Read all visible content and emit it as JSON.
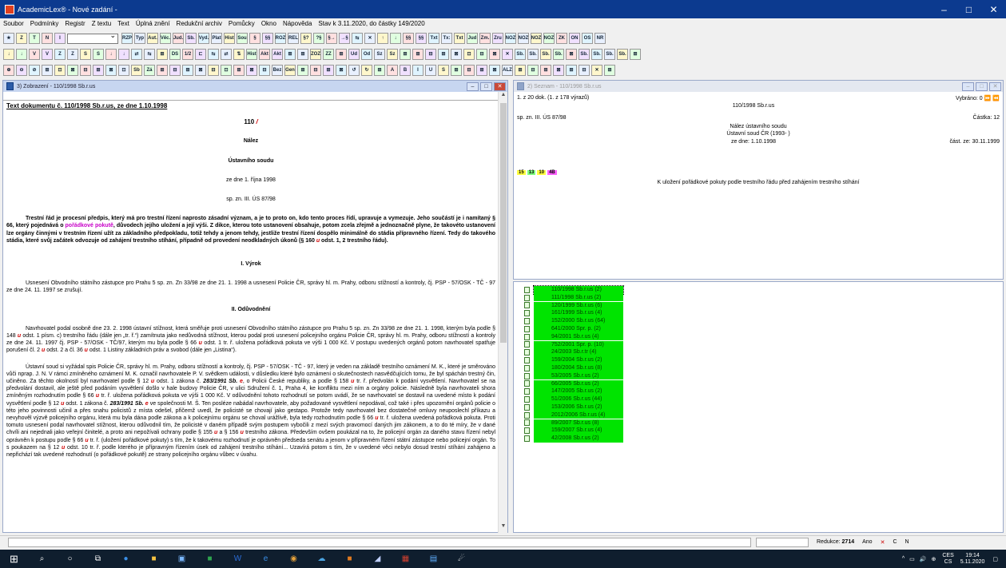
{
  "window": {
    "title": "AcademicLex® - Nové zadání -",
    "controls": [
      "–",
      "□",
      "✕"
    ]
  },
  "menu": [
    "Soubor",
    "Podmínky",
    "Registr",
    "Z textu",
    "Text",
    "Úplná znění",
    "Redukční archiv",
    "Pomůcky",
    "Okno",
    "Nápověda",
    "Stav k 3.11.2020, do částky 149/2020"
  ],
  "toolbar": {
    "row1a": [
      "Z",
      "T",
      "N",
      "I"
    ],
    "row1b": [
      "RZP",
      "Typ",
      "Aut.",
      "Věc.",
      "Jud.",
      "Sb.",
      "Vyd.",
      "Plat",
      "Hist",
      "Sou",
      "§",
      "§§",
      "ROZ",
      "REL",
      "§?",
      "?§",
      "§→",
      "→§",
      "⇆",
      "✕",
      "↑",
      "↓",
      "§§",
      "§§",
      "Txt",
      "Tx:",
      "Txt",
      "Jud",
      "Zm.",
      "Zru",
      "NOZ",
      "NOZ",
      "NOZ",
      "NOZ",
      "ZK",
      "ON",
      "OS",
      "NR"
    ],
    "row2": [
      "↓",
      "↓",
      "V",
      "V",
      "Z",
      "Z",
      "S",
      "S",
      "↓",
      "↓",
      "⇄",
      "⇆",
      "⊞",
      "DS",
      "1/2",
      "⊏",
      "⇆",
      "⇄",
      "⇅",
      "Hist",
      "Akt",
      "Akt",
      "⊞",
      "⊞",
      "ZOZ",
      "ZZ",
      "⊞",
      "Ud",
      "Od",
      "Sz",
      "Sz",
      "⊞",
      "⊞",
      "⊟",
      "⊞",
      "⊠",
      "⊡",
      "⊟",
      "⊠",
      "✕",
      "Sb.",
      "Sb.",
      "Sb.",
      "Sb.",
      "⊠",
      "Sb.",
      "Sb.",
      "Sb.",
      "Sb.",
      "⊞"
    ],
    "row3": [
      "⊕",
      "⊖",
      "⊘",
      "⊞",
      "⊡",
      "⊠",
      "⊟",
      "⊞",
      "⊠",
      "⊡",
      "Sb",
      "Zá",
      "⊞",
      "⊟",
      "⊞",
      "⊠",
      "⊟",
      "⊡",
      "⊞",
      "⊠",
      "⊟",
      "Bez",
      "Gen",
      "⊞",
      "⊟",
      "⊞",
      "⊠",
      "↺",
      "↻",
      "⊞",
      "A",
      "B",
      "I",
      "U",
      "S",
      "⊞",
      "⊟",
      "⊞",
      "⊠",
      "ALZ",
      "⊞",
      "⊟",
      "⊞",
      "⊠",
      "⊞",
      "⊟",
      "✕",
      "⊞"
    ]
  },
  "left_pane": {
    "title": "3) Zobrazení - 110/1998 Sb.r.us"
  },
  "doc": {
    "header": "Text dokumentu č. 110/1998 Sb.r.us, ze dne 1.10.1998",
    "num": "110 ",
    "num_suffix": "/",
    "nalez": "Nález",
    "court": "Ústavního soudu",
    "date": "ze dne 1. října 1998",
    "spzn": "sp. zn. III. ÚS 87/98",
    "summary_a": "Trestní řád je procesní předpis, který má pro trestní řízení naprosto zásadní význam, a je to proto on, kdo tento proces řídí, upravuje a vymezuje. Jeho součástí je i namítaný § 66, který pojednává o ",
    "summary_hl": "pořádkové pokutě",
    "summary_b": ", důvodech jejího uložení a její výši. Z dikce, kterou toto ustanovení obsahuje, potom zcela zřejmě a jednoznačně plyne, že takovéto ustanovení lze orgány činnými v trestním řízení užít za základního předpokladu, totiž tehdy a jenom tehdy, jestliže trestní řízení dospělo minimálně do stádia přípravného řízení. Tedy do takového stádia, které svůj začátek odvozuje od zahájení trestního stíhání, případně od provedení neodkladných úkonů (§ 160 ",
    "summary_u": "u",
    "summary_c": " odst. 1, 2 trestního řádu).",
    "sec1": "I. Výrok",
    "vyrok": "Usnesení Obvodního státního zástupce pro Prahu 5 sp. zn. Zn 33/98 ze dne 21. 1. 1998 a usnesení Policie ČR, správy hl. m. Prahy, odboru stížností a kontroly, čj. PSP - 57/OSK - TČ - 97 ze dne 24. 11. 1997 se zrušují.",
    "sec2": "II. Odůvodnění",
    "p1_a": "Navrhovatel podal osobně dne 23. 2. 1998 ústavní stížnost, která směřuje proti usnesení Obvodního státního zástupce pro Prahu 5 sp. zn. Zn 33/98 ze dne 21. 1. 1998, kterým byla podle § 148 ",
    "p1_u1": "u",
    "p1_b": " odst. 1 písm. c) trestního řádu (dále jen „tr. ř.“) zamítnuta jako nedůvodná stížnost, kterou podal proti usnesení policejního orgánu Policie ČR, správy hl. m. Prahy, odboru stížností a kontroly ze dne 24. 11. 1997 čj. PSP - 57/OSK - TČ/97, kterým mu byla podle § 66 ",
    "p1_u2": "u",
    "p1_c": " odst. 1 tr. ř. uložena pořádková pokuta ve výši 1 000 Kč. V postupu uvedených orgánů potom navrhovatel spatřuje porušení čl. 2 ",
    "p1_u3": "u",
    "p1_d": " odst. 2 a čl. 36 ",
    "p1_u4": "u",
    "p1_e": " odst. 1 Listiny základních práv a svobod (dále jen „Listina“).",
    "p2_a": "Ústavní soud si vyžádal spis Policie ČR, správy hl. m. Prahy, odboru stížností a kontroly, čj. PSP - 57/OSK - TČ - 97, který je veden na základě trestního oznámení M. K., které je směrováno vůči nprap. J. N. V rámci zmíněného oznámení M. K. označil navrhovatele P. V. svědkem události, v důsledku které bylo oznámení o skutečnostech nasvědčujících tomu, že byl spáchán trestný čin, učiněno. Za těchto okolností byl navrhovatel podle § 12 ",
    "p2_u1": "u",
    "p2_b": " odst. 1 zákona č. ",
    "p2_law1": "283/1991 Sb.",
    "p2_e1": " e",
    "p2_c": ", o Policii České republiky, a podle § 158 ",
    "p2_u2": "u",
    "p2_d": " tr. ř. předvolán k podání vysvětlení. Navrhovatel se na předvolání dostavil, ale ještě před podáním vysvětlení došlo v hale budovy Policie ČR, v ulici Sdružení č. 1, Praha 4, ke konfliktu mezi ním a orgány policie. Následně byla navrhovateli shora zmíněným rozhodnutím podle § 66 ",
    "p2_u3": "u",
    "p2_f": " tr. ř. uložena pořádková pokuta ve výši 1 000 Kč. V odůvodnění tohoto rozhodnutí se potom uvádí, že se navrhovatel se dostavil na uvedené místo k podání vysvětlení podle § 12 ",
    "p2_u4": "u",
    "p2_g": " odst. 1 zákona č. ",
    "p2_law2": "283/1991 Sb.",
    "p2_e2": " e",
    "p2_h": " ve společnosti M. Š. Ten posléze nabádal navrhovatele, aby požadované vysvětlení nepodával, což také i přes upozornění orgánů policie o této jeho povinnosti učinil a přes snahu policistů z místa odešel, přičemž uvedl, že policisté se chovají jako gestapo. Protože tedy navrhovatel bez dostatečné omluvy neuposlechl příkazu a nevyhověl výzvě policejního orgánu, která mu byla dána podle zákona a k policejnímu orgánu se choval urážlivě, byla tedy rozhodnutím podle § 66 ",
    "p2_u5": "u",
    "p2_i": " tr. ř. uložena uvedená pořádková pokuta. Proti tomuto usnesení podal navrhovatel stížnost, kterou odůvodnil tím, že policisté v daném případě svým postupem vybočili z mezí svých pravomocí daných jim zákonem, a to do té míry, že v dané chvíli ani nejednali jako veřejní činitelé, a proto ani nepožívali ochrany podle § 155 ",
    "p2_u6": "u",
    "p2_j": " a § 156 ",
    "p2_u7": "u",
    "p2_k": " trestního zákona. Především ovšem poukázal na to, že policejní orgán za daného stavu řízení nebyl oprávněn k postupu podle § 66 ",
    "p2_u8": "u",
    "p2_l": " tr. ř. (uložení pořádkové pokuty) s tím, že k takovému rozhodnutí je oprávněn předseda senátu a jenom v přípravném řízení státní zástupce nebo policejní orgán. To s poukazem na § 12 ",
    "p2_u9": "u",
    "p2_m": " odst. 10 tr. ř. podle kterého je přípravným řízením úsek od zahájení trestního stíhání... Uzavírá potom s tím, že v uvedené věci nebylo dosud trestní stíhání zahájeno a nepřichází tak uvedené rozhodnutí (o pořádkové pokutě) ze strany policejního orgánu vůbec v úvahu."
  },
  "right_top": {
    "title": "2) Seznam - 110/1998 Sb.r.us",
    "count": "1. z 20 dok. (1. z 178 výrazů)",
    "docid": "110/1998 Sb.r.us",
    "selected": "Vybráno: 0",
    "spzn": "sp. zn. III. ÚS 87/98",
    "castka": "Částka: 12",
    "type": "Nález ústavního soudu",
    "court": "Ústavní soud ČR (1993-    )",
    "date": "ze dne: 1.10.1998",
    "cast_date": "část. ze: 30.11.1999",
    "tags": [
      "15",
      "13",
      "10",
      "4B"
    ],
    "subject": "K uložení pořádkové pokuty podle trestního řádu před zahájením trestního stíhání"
  },
  "list": [
    "110/1998 Sb.r.us (2)",
    "111/1998 Sb.r.us (2)",
    "120/1999 Sb.r.us (6)",
    "161/1999 Sb.r.us (4)",
    "152/2000 Sb.r.us (64)",
    "641/2000 Spr. p. (2)",
    "94/2001 Sb.r.us (4)",
    "752/2001 Spr. p. (10)",
    "24/2003 Sb.r.tr (4)",
    "159/2004 Sb.r.us (2)",
    "180/2004 Sb.r.us (8)",
    "53/2005 Sb.r.us (2)",
    "66/2005 Sb.r.us (2)",
    "147/2005 Sb.r.us (2)",
    "51/2006 Sb.r.us (44)",
    "153/2006 Sb.r.us (2)",
    "2012/2006 Sb.r.us (4)",
    "89/2007 Sb.r.us (8)",
    "159/2007 Sb.r.us (4)",
    "42/2008 Sb.r.us (2)"
  ],
  "status": {
    "redukce_label": "Redukce:",
    "redukce_value": "2714",
    "ano": "Ano",
    "c": "C",
    "n": "N"
  },
  "tray": {
    "lang1": "CES",
    "lang2": "CS",
    "time": "19:14",
    "date": "5.11.2020"
  },
  "colors": {
    "titlebar": "#0c3a8f",
    "list_bg": "#00e400",
    "highlight": "#c800c8",
    "red_u": "#d00000"
  }
}
